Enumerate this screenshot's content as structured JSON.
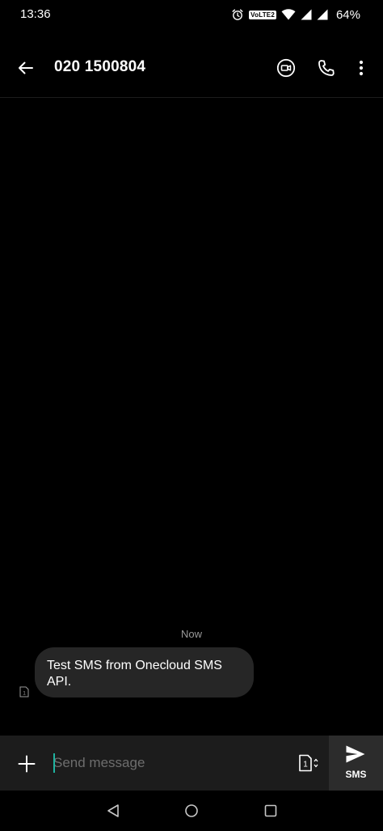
{
  "status_bar": {
    "time": "13:36",
    "network_badge": "VoLTE2",
    "battery": "64%"
  },
  "app_bar": {
    "title": "020 1500804",
    "icons": [
      "back-arrow-icon",
      "video-call-icon",
      "phone-icon",
      "more-vert-icon"
    ]
  },
  "thread": {
    "timestamp": "Now",
    "messages": [
      {
        "direction": "incoming",
        "sim": "1",
        "text": "Test SMS from Onecloud SMS API."
      }
    ]
  },
  "composer": {
    "placeholder": "Send message",
    "sim_label": "1",
    "send_label": "SMS"
  },
  "colors": {
    "background": "#000000",
    "bubble": "#262626",
    "composer": "#1c1c1c",
    "send_button": "#2c2c2c",
    "cursor": "#1fb3a0",
    "timestamp": "#9a9a9a"
  }
}
